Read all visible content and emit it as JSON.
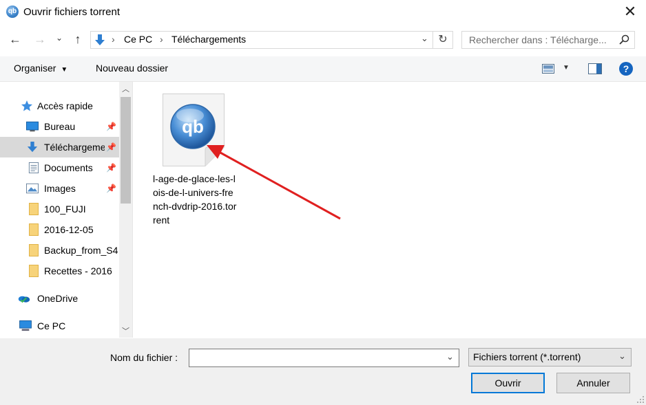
{
  "window": {
    "title": "Ouvrir fichiers torrent",
    "app_icon_text": "qb",
    "close_glyph": "✕"
  },
  "nav": {
    "back": "←",
    "forward": "→",
    "recent": "⌄",
    "up": "↑"
  },
  "address": {
    "crumbs": [
      "Ce PC",
      "Téléchargements"
    ],
    "separator": "›",
    "dropdown": "⌄",
    "refresh": "↻"
  },
  "search": {
    "placeholder": "Rechercher dans : Télécharge...",
    "icon": "search-icon"
  },
  "toolbar": {
    "organise_label": "Organiser",
    "new_folder_label": "Nouveau dossier",
    "help_glyph": "?"
  },
  "sidebar": {
    "items": [
      {
        "label": "Accès rapide",
        "icon": "star-icon"
      },
      {
        "label": "Bureau",
        "icon": "desktop-icon",
        "pinned": true
      },
      {
        "label": "Téléchargements",
        "icon": "download-arrow-icon",
        "pinned": true,
        "selected": true
      },
      {
        "label": "Documents",
        "icon": "document-icon",
        "pinned": true
      },
      {
        "label": "Images",
        "icon": "image-icon",
        "pinned": true
      },
      {
        "label": "100_FUJI",
        "icon": "folder-icon"
      },
      {
        "label": "2016-12-05",
        "icon": "folder-icon"
      },
      {
        "label": "Backup_from_S4",
        "icon": "folder-icon"
      },
      {
        "label": "Recettes - 2016",
        "icon": "folder-icon"
      },
      {
        "label": "OneDrive",
        "icon": "onedrive-icon"
      },
      {
        "label": "Ce PC",
        "icon": "computer-icon"
      }
    ]
  },
  "content": {
    "file": {
      "name": "l-age-de-glace-les-lois-de-l-univers-french-dvdrip-2016.torrent",
      "icon_text": "qb"
    }
  },
  "footer": {
    "filename_label": "Nom du fichier :",
    "filename_value": "",
    "filetype_value": "Fichiers torrent (*.torrent)",
    "open_label": "Ouvrir",
    "cancel_label": "Annuler"
  },
  "colors": {
    "accent": "#0078d7",
    "arrow": "#e02020",
    "selected_bg": "#d9d9d9"
  }
}
